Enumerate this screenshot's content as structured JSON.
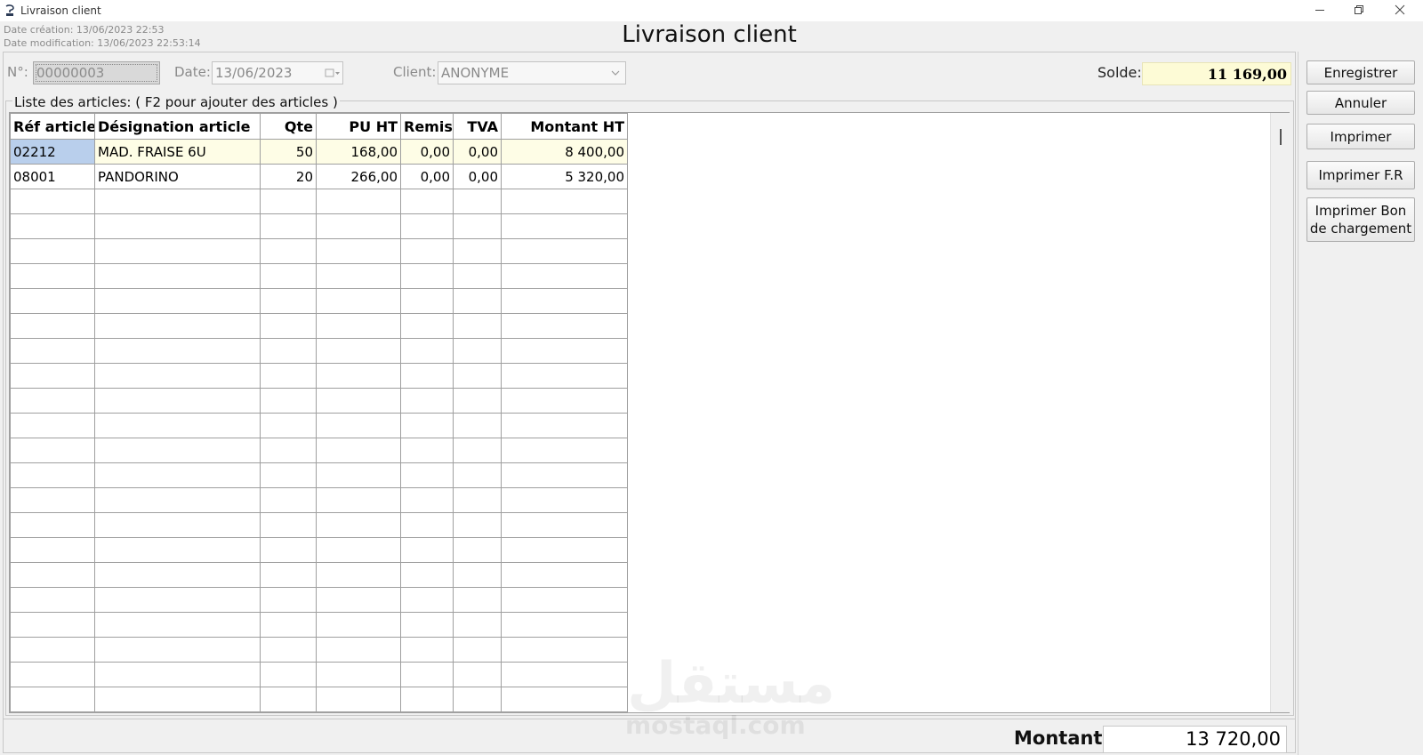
{
  "window": {
    "title": "Livraison client"
  },
  "header": {
    "date_creation": "Date création: 13/06/2023 22:53",
    "date_modification": "Date modification: 13/06/2023 22:53:14",
    "page_title": "Livraison client"
  },
  "form": {
    "numero_label": "N°:",
    "numero_value": "00000003",
    "date_label": "Date:",
    "date_value": "13/06/2023",
    "client_label": "Client:",
    "client_value": "ANONYME",
    "solde_label": "Solde:",
    "solde_value": "11 169,00"
  },
  "articles": {
    "legend": "Liste des articles:  ( F2 pour ajouter des articles )",
    "columns": [
      "Réf article",
      "Désignation article",
      "Qte",
      "PU HT",
      "Remis",
      "TVA",
      "Montant HT"
    ],
    "rows": [
      [
        "02212",
        "MAD. FRAISE 6U",
        "50",
        "168,00",
        "0,00",
        "0,00",
        "8 400,00"
      ],
      [
        "08001",
        "PANDORINO",
        "20",
        "266,00",
        "0,00",
        "0,00",
        "5 320,00"
      ]
    ]
  },
  "actions": {
    "enregistrer": "Enregistrer",
    "annuler": "Annuler",
    "imprimer": "Imprimer",
    "imprimer_fr": "Imprimer F.R",
    "imprimer_bon_1": "Imprimer Bon",
    "imprimer_bon_2": "de chargement"
  },
  "footer": {
    "montant_label": "Montant:",
    "montant_value": "13 720,00"
  },
  "watermark": {
    "arabic": "مستقل",
    "latin": "mostaql.com"
  },
  "colors": {
    "selected_row": "#fefde6",
    "focused_cell": "#b9cfec",
    "solde_background": "#fdfbd6"
  }
}
